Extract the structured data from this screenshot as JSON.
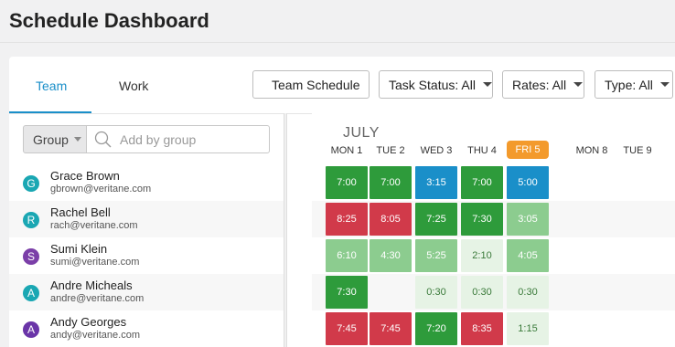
{
  "page": {
    "title": "Schedule Dashboard"
  },
  "tabs": [
    {
      "label": "Team",
      "active": true
    },
    {
      "label": "Work",
      "active": false
    }
  ],
  "toolbar": {
    "team_schedule": "Team Schedule",
    "task_status": "Task Status: All",
    "rates": "Rates: All",
    "type": "Type: All"
  },
  "filter": {
    "group_label": "Group",
    "search_placeholder": "Add by group"
  },
  "people": [
    {
      "initial": "G",
      "name": "Grace Brown",
      "email": "gbrown@veritane.com",
      "color": "#1aa7b3"
    },
    {
      "initial": "R",
      "name": "Rachel Bell",
      "email": "rach@veritane.com",
      "color": "#1aa7b3"
    },
    {
      "initial": "S",
      "name": "Sumi Klein",
      "email": "sumi@veritane.com",
      "color": "#7b3fa8"
    },
    {
      "initial": "A",
      "name": "Andre Micheals",
      "email": "andre@veritane.com",
      "color": "#1aa7b3"
    },
    {
      "initial": "A",
      "name": "Andy Georges",
      "email": "andy@veritane.com",
      "color": "#6a35a8"
    }
  ],
  "calendar": {
    "month": "JULY",
    "days": [
      "MON 1",
      "TUE 2",
      "WED 3",
      "THU 4",
      "FRI 5",
      "MON 8",
      "TUE 9"
    ],
    "today": "FRI 5",
    "colors": {
      "green": "#2e9b3b",
      "blue": "#1a8fc9",
      "red": "#d13a4a",
      "light": "#8ccc8f",
      "pale": "#e6f3e5",
      "today": "#f39a2c"
    },
    "rows": [
      [
        {
          "t": "7:00",
          "c": "green"
        },
        {
          "t": "7:00",
          "c": "green"
        },
        {
          "t": "3:15",
          "c": "blue"
        },
        {
          "t": "7:00",
          "c": "green"
        },
        {
          "t": "5:00",
          "c": "blue"
        }
      ],
      [
        {
          "t": "8:25",
          "c": "red"
        },
        {
          "t": "8:05",
          "c": "red"
        },
        {
          "t": "7:25",
          "c": "green"
        },
        {
          "t": "7:30",
          "c": "green"
        },
        {
          "t": "3:05",
          "c": "light"
        }
      ],
      [
        {
          "t": "6:10",
          "c": "light"
        },
        {
          "t": "4:30",
          "c": "light"
        },
        {
          "t": "5:25",
          "c": "light"
        },
        {
          "t": "2:10",
          "c": "pale"
        },
        {
          "t": "4:05",
          "c": "light"
        }
      ],
      [
        {
          "t": "7:30",
          "c": "green"
        },
        null,
        {
          "t": "0:30",
          "c": "pale"
        },
        {
          "t": "0:30",
          "c": "pale"
        },
        {
          "t": "0:30",
          "c": "pale"
        }
      ],
      [
        {
          "t": "7:45",
          "c": "red"
        },
        {
          "t": "7:45",
          "c": "red"
        },
        {
          "t": "7:20",
          "c": "green"
        },
        {
          "t": "8:35",
          "c": "red"
        },
        {
          "t": "1:15",
          "c": "pale"
        }
      ]
    ]
  }
}
